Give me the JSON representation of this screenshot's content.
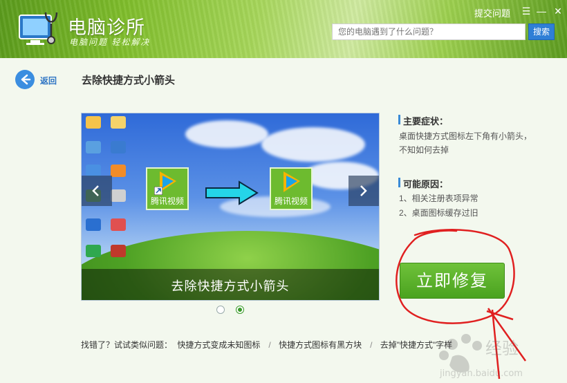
{
  "header": {
    "app_title": "电脑诊所",
    "slogan": "电脑问题 轻松解决",
    "report_link": "提交问题",
    "search_placeholder": "您的电脑遇到了什么问题？",
    "search_button": "搜索",
    "window_menu": "☰",
    "window_minimize": "—",
    "window_close": "✕"
  },
  "nav": {
    "back_label": "返回",
    "page_title": "去除快捷方式小箭头"
  },
  "preview": {
    "caption": "去除快捷方式小箭头",
    "before_icon_label": "腾讯视频",
    "after_icon_label": "腾讯视频",
    "prev_icon": "chevron-left-icon",
    "next_icon": "chevron-right-icon",
    "slide_count": 2,
    "active_slide": 2
  },
  "symptoms": {
    "title": "主要症状：",
    "lines": [
      "桌面快捷方式图标左下角有小箭头，",
      "不知如何去掉"
    ]
  },
  "causes": {
    "title": "可能原因：",
    "lines": [
      "1、相关注册表项异常",
      "2、桌面图标缓存过旧"
    ]
  },
  "fix_button": "立即修复",
  "related": {
    "prompt": "找错了？试试类似问题：",
    "items": [
      "快捷方式变成未知图标",
      "快捷方式图标有黑方块",
      "去掉\"快捷方式\"字样"
    ]
  },
  "colors": {
    "brand_green": "#4aa21f",
    "link_blue": "#2d74c4",
    "search_blue": "#2f7fd6",
    "annotation_red": "#e02020"
  }
}
